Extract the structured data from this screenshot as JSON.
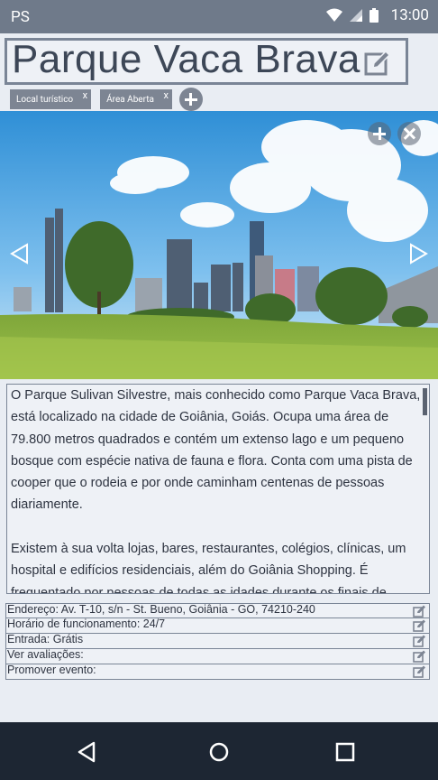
{
  "status_bar": {
    "carrier": "PS",
    "time": "13:00"
  },
  "place": {
    "title": "Parque Vaca Brava"
  },
  "tags": [
    {
      "label": "Local turístico",
      "remove": "x"
    },
    {
      "label": "Área Aberta",
      "remove": "x"
    }
  ],
  "description": {
    "paragraphs": [
      "O Parque Sulivan Silvestre, mais conhecido como Parque Vaca Brava, está localizado na cidade de Goiânia, Goiás. Ocupa uma área de 79.800 metros quadrados e contém um extenso lago e um pequeno bosque com espécie nativa de fauna e flora. Conta com uma pista de cooper que o rodeia e por onde caminham centenas de pessoas diariamente.",
      "Existem à sua volta lojas, bares, restaurantes, colégios, clínicas, um hospital e edifícios residenciais, além do Goiânia Shopping. É frequentado por pessoas de todas as idades durante os finais de semana."
    ]
  },
  "info": {
    "address": "Endereço: Av. T-10, s/n - St. Bueno, Goiânia - GO, 74210-240",
    "hours": "Horário de funcionamento: 24/7",
    "entry": "Entrada: Grátis",
    "reviews": "Ver avaliações:",
    "promote": "Promover evento:"
  },
  "colors": {
    "status_bar": "#6f7a8a",
    "accent": "#7d8593",
    "nav_bar": "#1d2633"
  },
  "icons": {
    "title_edit": "edit-icon",
    "add_tag": "add-circle-icon",
    "gallery_add": "add-circle-icon",
    "gallery_remove": "close-circle-icon",
    "prev": "triangle-left-icon",
    "next": "triangle-right-icon",
    "nav": [
      "back-icon",
      "home-icon",
      "recents-icon"
    ]
  }
}
